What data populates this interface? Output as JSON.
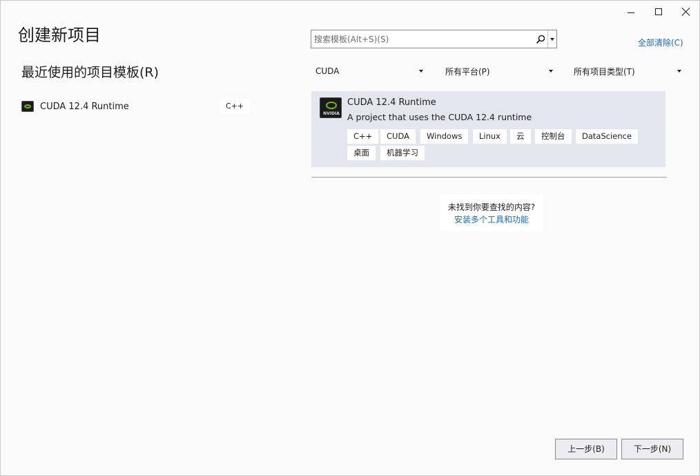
{
  "window": {
    "controls": [
      "minimize-icon",
      "maximize-icon",
      "close-icon"
    ]
  },
  "page": {
    "title": "创建新项目"
  },
  "recent": {
    "heading": "最近使用的项目模板(R)",
    "items": [
      {
        "label": "CUDA 12.4 Runtime",
        "tag": "C++",
        "icon": "nvidia-icon"
      }
    ]
  },
  "search": {
    "placeholder": "搜索模板(Alt+S)(S)",
    "value": ""
  },
  "clear_all": "全部清除(C)",
  "filters": {
    "language": "CUDA",
    "platform": "所有平台(P)",
    "project_type": "所有项目类型(T)"
  },
  "templates": [
    {
      "title": "CUDA 12.4 Runtime",
      "description": "A project that uses the CUDA 12.4 runtime",
      "icon": "nvidia-icon",
      "tags": [
        "C++",
        "CUDA",
        "Windows",
        "Linux",
        "云",
        "控制台",
        "DataScience",
        "桌面",
        "机器学习"
      ]
    }
  ],
  "not_found": {
    "text": "未找到你要查找的内容?",
    "link": "安装多个工具和功能"
  },
  "buttons": {
    "back": "上一步(B)",
    "next": "下一步(N)"
  },
  "colors": {
    "accent_link": "#1a6bb5",
    "card_background": "#e3e6ec",
    "nvidia_green": "#76b900"
  }
}
